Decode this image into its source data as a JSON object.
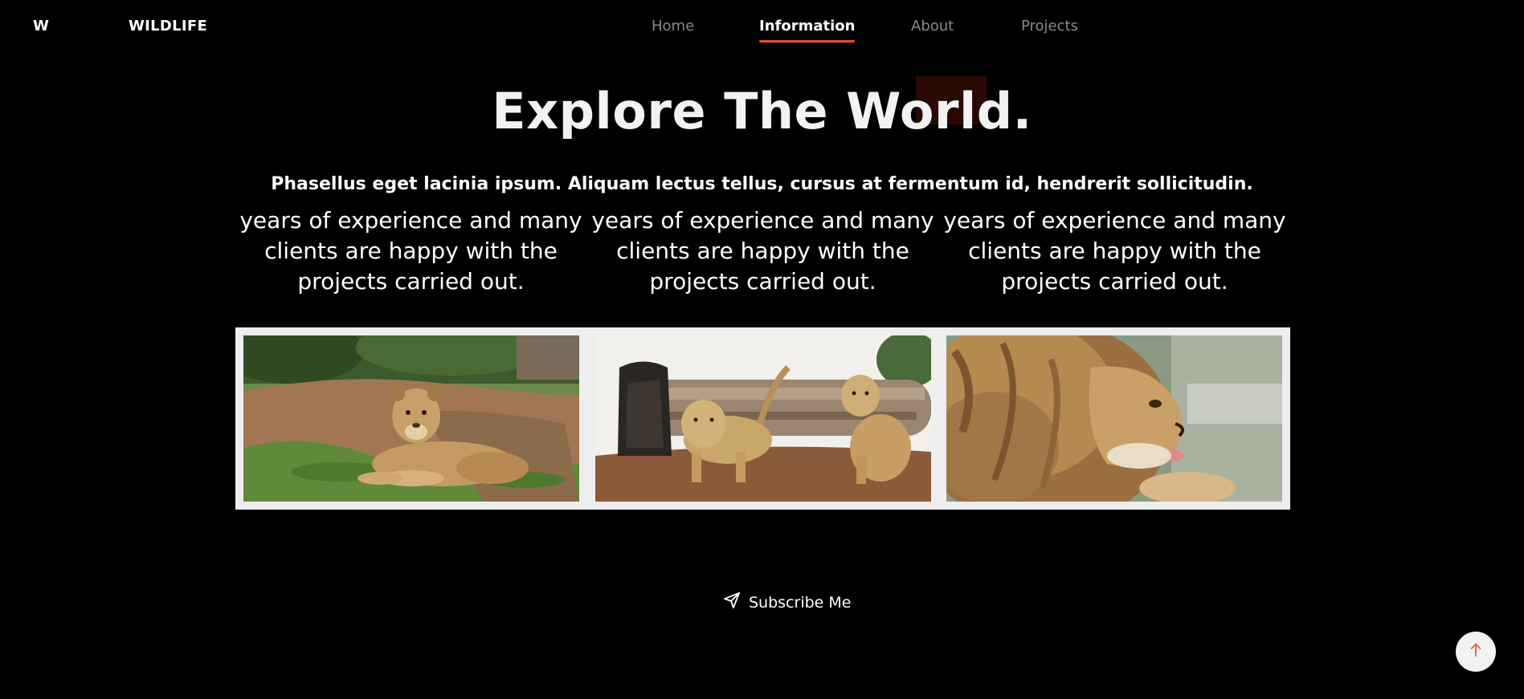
{
  "header": {
    "logo": "W",
    "brand": "WILDLIFE",
    "nav": [
      {
        "label": "Home",
        "active": false
      },
      {
        "label": "Information",
        "active": true
      },
      {
        "label": "About",
        "active": false
      },
      {
        "label": "Projects",
        "active": false
      }
    ]
  },
  "hero": {
    "title": "Explore The World.",
    "subtitle": "Phasellus eget lacinia ipsum. Aliquam lectus tellus, cursus at fermentum id, hendrerit sollicitudin."
  },
  "columns": [
    {
      "text": "years of experience and many clients are happy with the projects carried out."
    },
    {
      "text": "years of experience and many clients are happy with the projects carried out."
    },
    {
      "text": "years of experience and many clients are happy with the projects carried out."
    }
  ],
  "gallery": {
    "images": [
      {
        "subject": "lion cub lying on grass"
      },
      {
        "subject": "two lion cubs by a log"
      },
      {
        "subject": "male lion profile"
      }
    ]
  },
  "subscribe": {
    "label": "Subscribe Me",
    "icon": "send-icon"
  },
  "back_to_top": {
    "icon": "arrow-up-icon"
  },
  "colors": {
    "background": "#000000",
    "accent": "#e8501e",
    "accent_box": "#2a0804",
    "gallery_frame": "#eeeeee"
  }
}
